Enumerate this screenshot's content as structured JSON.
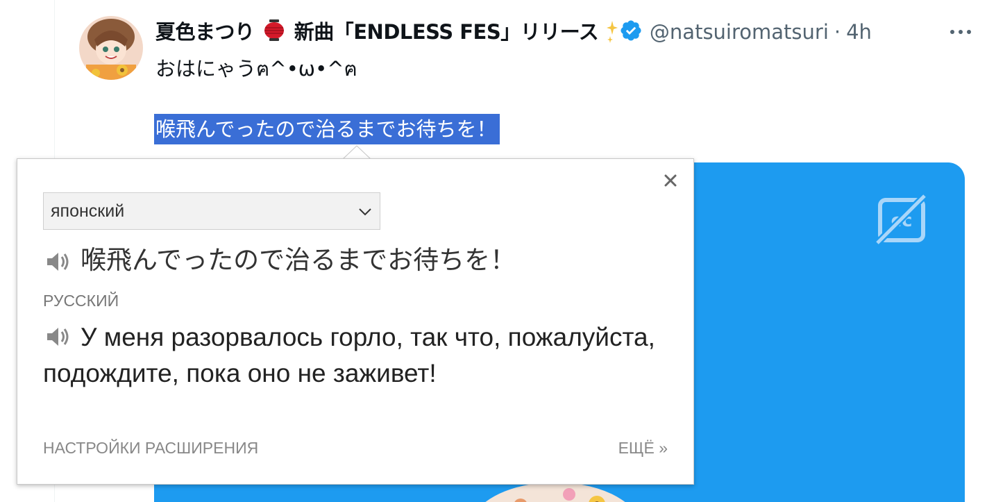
{
  "tweet": {
    "display_name_part1": "夏色まつり",
    "display_name_part2": "新曲「ENDLESS FES」リリース",
    "handle": "@natsuiromatsuri",
    "separator": "·",
    "timestamp": "4h",
    "line1": "おはにゃうฅ^•ω•^ฅ",
    "selected_text": "喉飛んでったので治るまでお待ちを！"
  },
  "translator": {
    "source_language": "японский",
    "source_text": "喉飛んでったので治るまでお待ちを！",
    "target_language_label": "РУССКИЙ",
    "translation": "У меня разорвалось горло, так что, пожалуйста, подождите, пока оно не заживет!",
    "settings_link": "НАСТРОЙКИ РАСШИРЕНИЯ",
    "more_link": "ЕЩЁ »",
    "close_glyph": "×"
  },
  "colors": {
    "accent_blue": "#1d9bf0",
    "selection": "#3a6ed6",
    "verified": "#1d9bf0"
  }
}
